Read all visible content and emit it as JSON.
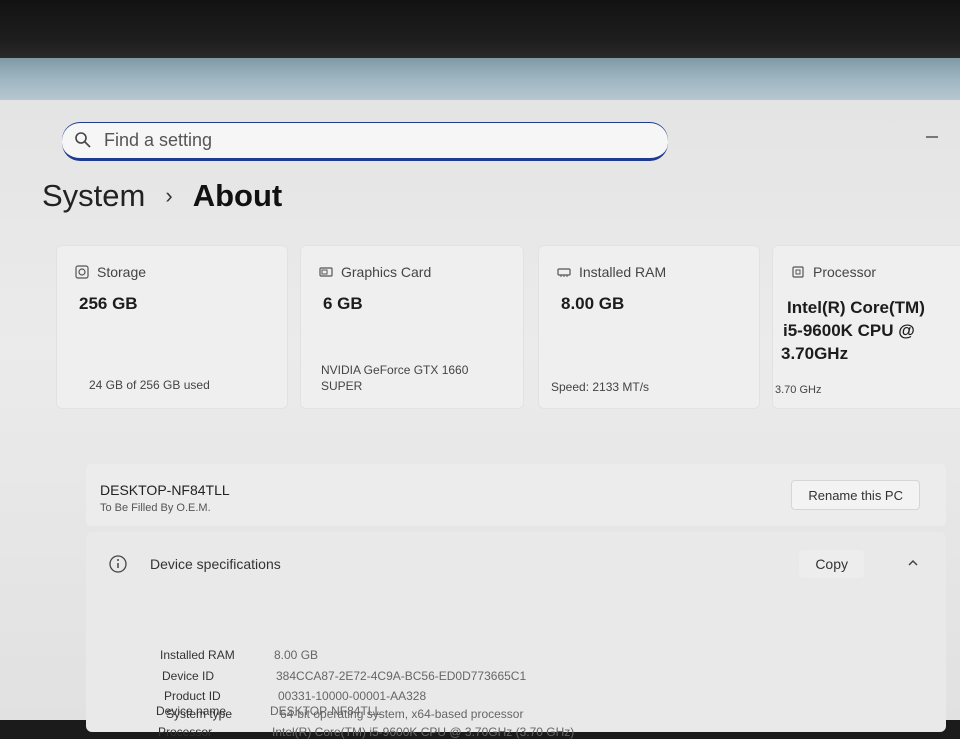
{
  "search": {
    "placeholder": "Find a setting"
  },
  "breadcrumb": {
    "parent": "System",
    "current": "About"
  },
  "cards": {
    "storage": {
      "label": "Storage",
      "value": "256 GB",
      "foot": "24 GB of 256 GB used"
    },
    "graphics": {
      "label": "Graphics Card",
      "value": "6 GB",
      "foot_line1": "NVIDIA GeForce GTX 1660",
      "foot_line2": "SUPER"
    },
    "ram": {
      "label": "Installed RAM",
      "value": "8.00 GB",
      "foot": "Speed: 2133 MT/s"
    },
    "processor": {
      "label": "Processor",
      "value_line1": "Intel(R) Core(TM)",
      "value_line2": "i5-9600K CPU @",
      "value_line3": "3.70GHz",
      "foot": "3.70 GHz"
    }
  },
  "device": {
    "name": "DESKTOP-NF84TLL",
    "subtitle": "To Be Filled By O.E.M.",
    "rename_label": "Rename this PC"
  },
  "specs": {
    "title": "Device specifications",
    "copy_label": "Copy",
    "rows": [
      {
        "key": "Device name",
        "value": "DESKTOP-NF84TLL"
      },
      {
        "key": "Processor",
        "value": "Intel(R) Core(TM) i5-9600K CPU @ 3.70GHz (3.70 GHz)"
      },
      {
        "key": "Installed RAM",
        "value": "8.00 GB"
      },
      {
        "key": "Device ID",
        "value": "384CCA87-2E72-4C9A-BC56-ED0D773665C1"
      },
      {
        "key": "Product ID",
        "value": "00331-10000-00001-AA328"
      },
      {
        "key": "System type",
        "value": "64-bit operating system, x64-based processor"
      }
    ]
  }
}
